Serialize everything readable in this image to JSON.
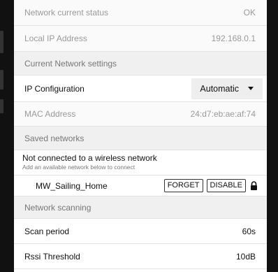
{
  "status_section": {
    "network_status_label": "Network current status",
    "network_status_value": "OK",
    "local_ip_label": "Local IP Address",
    "local_ip_value": "192.168.0.1"
  },
  "current_network_settings": {
    "header": "Current Network settings",
    "ip_config_label": "IP Configuration",
    "ip_config_value": "Automatic",
    "mac_label": "MAC Address",
    "mac_value": "24:d7:eb:ae:af:74"
  },
  "saved_networks": {
    "header": "Saved networks",
    "not_connected_title": "Not connected to a wireless network",
    "not_connected_subtitle": "Add an available network below to connect",
    "networks": [
      {
        "ssid": "MW_Sailing_Home",
        "forget_label": "FORGET",
        "disable_label": "DISABLE"
      }
    ]
  },
  "network_scanning": {
    "header": "Network scanning",
    "scan_period_label": "Scan period",
    "scan_period_value": "60s",
    "rssi_label": "Rssi Threshold",
    "rssi_value": "10dB"
  },
  "icons": {
    "dropdown": "chevron-down-icon",
    "lock": "lock-icon"
  }
}
